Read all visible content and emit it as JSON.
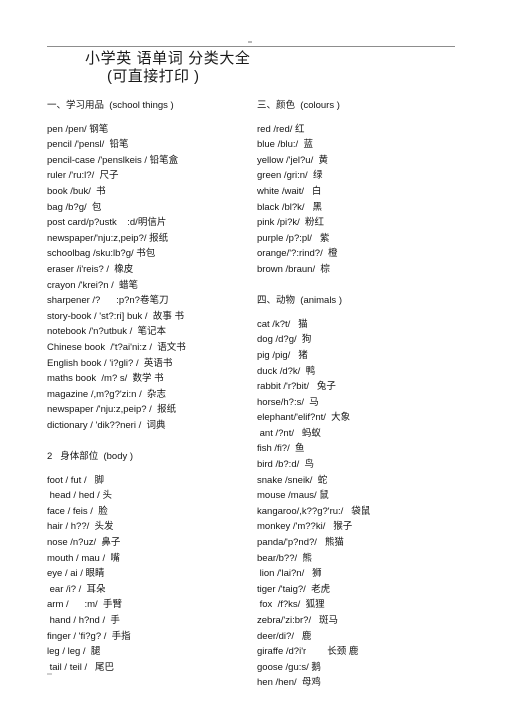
{
  "document": {
    "title_line_1": "小学英 语单词 分类大全",
    "title_line_2": "(可直接打印 )"
  },
  "left_column": {
    "section_1": {
      "heading": "一、学习用品  (school things )",
      "entries": [
        "pen /pen/ 钢笔",
        "pencil /'pensl/  铅笔",
        "pencil-case /'penslkeis / 铅笔盒",
        "ruler /'ru:l?/  尺子",
        "book /buk/  书",
        "bag /b?g/  包",
        "post card/p?ustk    :d/明信片",
        "newspaper/'nju:z,peip?/ 报纸",
        "schoolbag /sku:lb?g/ 书包",
        "eraser /i'reis? /  橡皮",
        "crayon /'krei?n /  蜡笔",
        "sharpener /?      :p?n?卷笔刀",
        "story-book / 'st?:ri] buk /  故事 书",
        "notebook /'n?utbuk /  笔记本",
        "Chinese book  /'t?ai'ni:z /  语文书",
        "English book / 'i?gli? /  英语书",
        "maths book  /m? s/  数学 书",
        "magazine /,m?g?'zi:n /  杂志",
        "newspaper /'nju:z,peip? /  报纸",
        "dictionary / 'dik??neri /  词典"
      ]
    },
    "section_2": {
      "heading": "2   身体部位  (body )",
      "entries": [
        "foot / fut /   脚",
        " head / hed / 头",
        "face / feis /  脸",
        "hair / h??/  头发",
        "nose /n?uz/  鼻子",
        "mouth / mau /  嘴",
        "eye / ai / 眼睛",
        " ear /i? /  耳朵",
        "arm /      :m/  手臂",
        " hand / h?nd /  手",
        "finger / 'fi?g? /  手指",
        "leg / leg /  腿",
        " tail / teil /   尾巴"
      ]
    }
  },
  "right_column": {
    "section_3": {
      "heading": "三、颜色  (colours )",
      "entries": [
        "red /red/ 红",
        "blue /blu:/  蓝",
        "yellow /'jel?u/  黄",
        "green /gri:n/  绿",
        "white /wait/   白",
        "black /bl?k/   黑",
        "pink /pi?k/  粉红",
        "purple /p?:pl/   紫",
        "orange/'?:rind?/  橙",
        "brown /braun/  棕"
      ]
    },
    "section_4": {
      "heading": "四、动物  (animals )",
      "entries": [
        "cat /k?t/   猫",
        "dog /d?g/  狗",
        "pig /pig/   猪",
        "duck /d?k/  鸭",
        "rabbit /'r?bit/   兔子",
        "horse/h?:s/  马",
        "elephant/'elif?nt/  大象",
        " ant /?nt/   蚂蚁",
        "fish /fi?/  鱼",
        "bird /b?:d/  鸟",
        "snake /sneik/  蛇",
        "mouse /maus/ 鼠",
        "kangaroo/,k??g?'ru:/   袋鼠",
        "monkey /'m??ki/   猴子",
        "panda/'p?nd?/   熊猫",
        "bear/b??/  熊",
        " lion /'lai?n/   狮",
        "tiger /'taig?/  老虎",
        " fox  /f?ks/  狐狸",
        "zebra/'zi:br?/   斑马",
        "deer/di?/   鹿",
        "giraffe /d?i'r        长颈 鹿",
        "goose /gu:s/ 鹅",
        "hen /hen/  母鸡"
      ]
    }
  }
}
